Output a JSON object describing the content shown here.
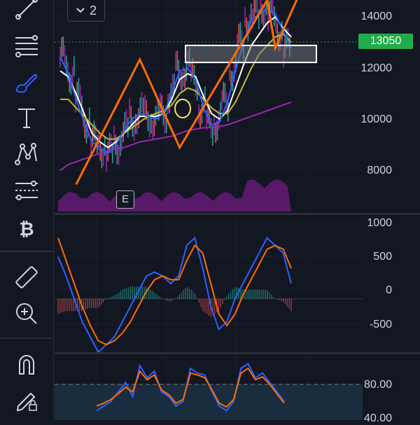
{
  "toolbar": {
    "tools": [
      {
        "name": "trend-line-icon"
      },
      {
        "name": "fib-retracement-icon"
      },
      {
        "name": "brush-icon"
      },
      {
        "name": "text-icon"
      },
      {
        "name": "pattern-icon"
      },
      {
        "name": "forecast-icon"
      },
      {
        "name": "bitcoin-icon"
      },
      {
        "name": "ruler-icon"
      },
      {
        "name": "zoom-in-icon"
      },
      {
        "name": "magnet-icon"
      },
      {
        "name": "lock-drawing-icon"
      }
    ],
    "accent_color": "#2962ff"
  },
  "header": {
    "interval_label": "2",
    "chevron_icon": "chevron-down-icon"
  },
  "price_pane": {
    "axis_ticks": [
      "14000",
      "12000",
      "10000",
      "8000"
    ],
    "last_price": "13050",
    "last_price_color": "#22ab4a",
    "earnings_marker": "E"
  },
  "macd_pane": {
    "axis_ticks": [
      "1000",
      "500",
      "0",
      "-500"
    ]
  },
  "rsi_pane": {
    "axis_ticks": [
      "80.00",
      "40.00"
    ]
  },
  "chart_data": [
    {
      "type": "line",
      "pane": "price",
      "y_axis": [
        7000,
        14500
      ],
      "grid": true,
      "series": [
        {
          "color": "#ffffff",
          "values": [
            12000,
            11800,
            11200,
            10500,
            9800,
            9500,
            9300,
            9500,
            9800,
            10100,
            10400,
            10400,
            10400,
            10500,
            11000,
            11700,
            11900,
            11800,
            11100,
            10500,
            10300,
            10600,
            11400,
            12200,
            12900,
            13300,
            13700,
            13900,
            13500,
            13200
          ]
        },
        {
          "color": "#c2b934",
          "values": [
            11000,
            11000,
            10700,
            10400,
            10100,
            9800,
            9600,
            9600,
            9800,
            10000,
            10200,
            10400,
            10500,
            10600,
            10800,
            11200,
            11400,
            11300,
            11000,
            10700,
            10500,
            10500,
            10900,
            11500,
            12100,
            12600,
            12900,
            13200,
            13300,
            13000
          ]
        },
        {
          "color": "#9c27b0",
          "values": [
            8500,
            8700,
            8800,
            8900,
            9000,
            9100,
            9200,
            9250,
            9300,
            9400,
            9500,
            9550,
            9600,
            9650,
            9700,
            9800,
            9900,
            9950,
            10000,
            10000,
            10050,
            10100,
            10200,
            10300,
            10400,
            10500,
            10600,
            10700,
            10800,
            10900
          ]
        },
        {
          "color": "#2962ff",
          "values": [
            12500,
            11900,
            11000,
            10200,
            9500,
            9300,
            9100,
            9400,
            9900,
            10300,
            10500,
            10400,
            10300,
            10500,
            11200,
            12000,
            12100,
            11700,
            10700,
            10100,
            10200,
            10900,
            12000,
            13000,
            13800,
            14000,
            14200,
            14000,
            13400,
            12800
          ]
        }
      ],
      "trend_line": {
        "color": "#ff6d00",
        "points": [
          [
            2,
            8000
          ],
          [
            10,
            12400
          ],
          [
            15,
            9300
          ],
          [
            26,
            14500
          ],
          [
            27,
            12800
          ],
          [
            30,
            14700
          ]
        ]
      }
    },
    {
      "type": "bar",
      "pane": "macd",
      "y_axis": [
        -700,
        1100
      ],
      "series": [
        {
          "color": "#2962ff",
          "values": [
            550,
            300,
            0,
            -300,
            -500,
            -700,
            -600,
            -500,
            -300,
            -100,
            100,
            300,
            350,
            300,
            200,
            300,
            700,
            800,
            400,
            -100,
            -400,
            -300,
            0,
            200,
            400,
            600,
            800,
            700,
            600,
            200
          ]
        },
        {
          "color": "#ff6d00",
          "values": [
            800,
            500,
            200,
            -100,
            -350,
            -550,
            -600,
            -550,
            -450,
            -300,
            -100,
            100,
            250,
            300,
            250,
            250,
            500,
            700,
            600,
            200,
            -200,
            -350,
            -200,
            50,
            250,
            450,
            650,
            700,
            650,
            400
          ]
        }
      ]
    },
    {
      "type": "line",
      "pane": "rsi",
      "y_axis": [
        30,
        100
      ],
      "series": [
        {
          "color": "#2962ff",
          "values": [
            40,
            45,
            50,
            60,
            70,
            55,
            88,
            75,
            82,
            60,
            55,
            45,
            50,
            85,
            80,
            78,
            60,
            45,
            40,
            50,
            85,
            90,
            75,
            80,
            70,
            60,
            50
          ]
        },
        {
          "color": "#ff6d00",
          "values": [
            45,
            48,
            52,
            58,
            65,
            60,
            82,
            73,
            78,
            62,
            57,
            48,
            52,
            80,
            78,
            75,
            62,
            48,
            44,
            52,
            80,
            85,
            73,
            76,
            68,
            58,
            48
          ]
        }
      ]
    }
  ]
}
